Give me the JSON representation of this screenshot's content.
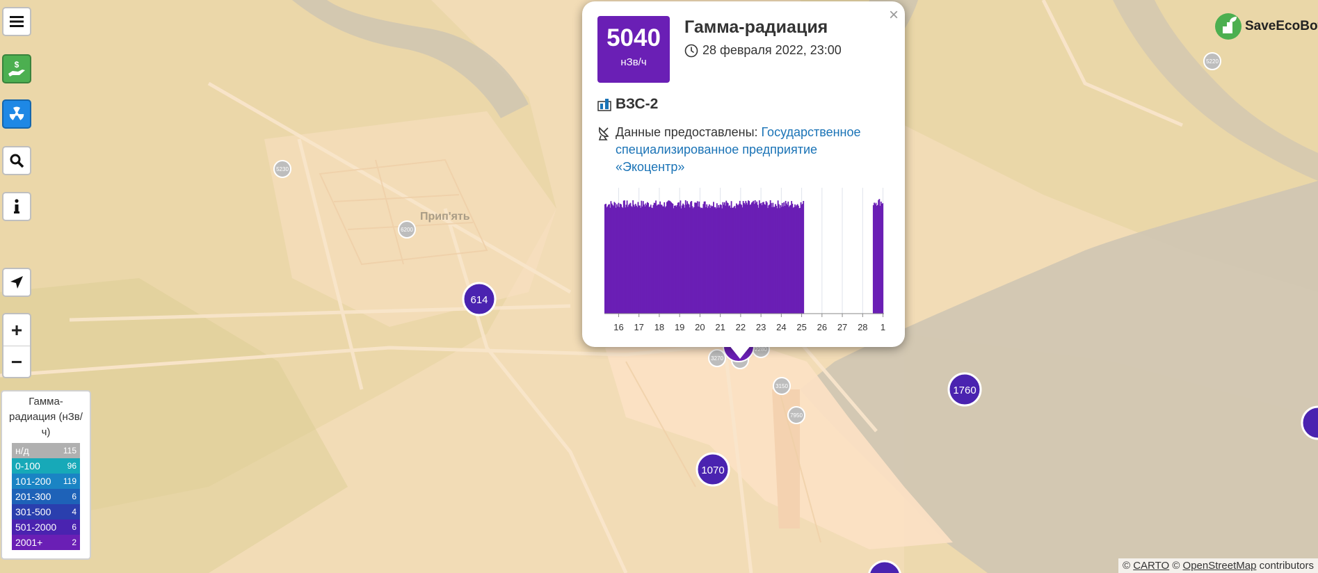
{
  "brand": {
    "name": "SaveEcoBot",
    "color": "#4caf50"
  },
  "controls": {
    "menu_icon": "hamburger-icon",
    "donate_icon": "hand-dollar-icon",
    "radiation_icon": "radiation-icon",
    "search_icon": "search-icon",
    "info_icon": "info-icon",
    "locate_icon": "location-arrow-icon",
    "zoom_in": "+",
    "zoom_out": "−"
  },
  "map": {
    "place_label": "Прип'ять",
    "large_markers": [
      {
        "value": "614"
      },
      {
        "value": "1760"
      },
      {
        "value": "1070"
      }
    ],
    "small_markers": [
      {
        "value": "5220"
      },
      {
        "value": "5230"
      },
      {
        "value": "6200"
      },
      {
        "value": "3270"
      },
      {
        "value": "3150"
      },
      {
        "value": "7950"
      },
      {
        "value": "2280"
      }
    ]
  },
  "popup": {
    "value": "5040",
    "unit": "нЗв/ч",
    "title": "Гамма-радиация",
    "date": "28 февраля 2022, 23:00",
    "station": "ВЗС-2",
    "source_prefix": "Данные предоставлены: ",
    "source_link": "Государственное специализированное предприятие «Экоцентр»",
    "close_label": "×",
    "accent_color": "#6a1fb5"
  },
  "chart_data": {
    "type": "bar",
    "x_tick_labels": [
      "16",
      "17",
      "18",
      "19",
      "20",
      "21",
      "22",
      "23",
      "24",
      "25",
      "26",
      "27",
      "28",
      "1"
    ],
    "data_ranges": [
      {
        "from_day": 15.3,
        "to_day": 25.1,
        "level": 0.93
      },
      {
        "from_day": 28.5,
        "to_day": 29.0,
        "level": 0.95
      }
    ],
    "color": "#6a1fb5",
    "grid": true
  },
  "legend": {
    "title": "Гамма-радиация (нЗв/ч)",
    "items": [
      {
        "range": "н/д",
        "count": "115",
        "color": "#b0b0b0"
      },
      {
        "range": "0-100",
        "count": "96",
        "color": "#17a9b8"
      },
      {
        "range": "101-200",
        "count": "119",
        "color": "#1a84c4"
      },
      {
        "range": "201-300",
        "count": "6",
        "color": "#1e62b8"
      },
      {
        "range": "301-500",
        "count": "4",
        "color": "#2a3fae"
      },
      {
        "range": "501-2000",
        "count": "6",
        "color": "#4a23b0"
      },
      {
        "range": "2001+",
        "count": "2",
        "color": "#6a1fb5"
      }
    ]
  },
  "attribution": {
    "prefix": "© ",
    "carto": "CARTO",
    "mid": " © ",
    "osm": "OpenStreetMap",
    "suffix": " contributors"
  }
}
